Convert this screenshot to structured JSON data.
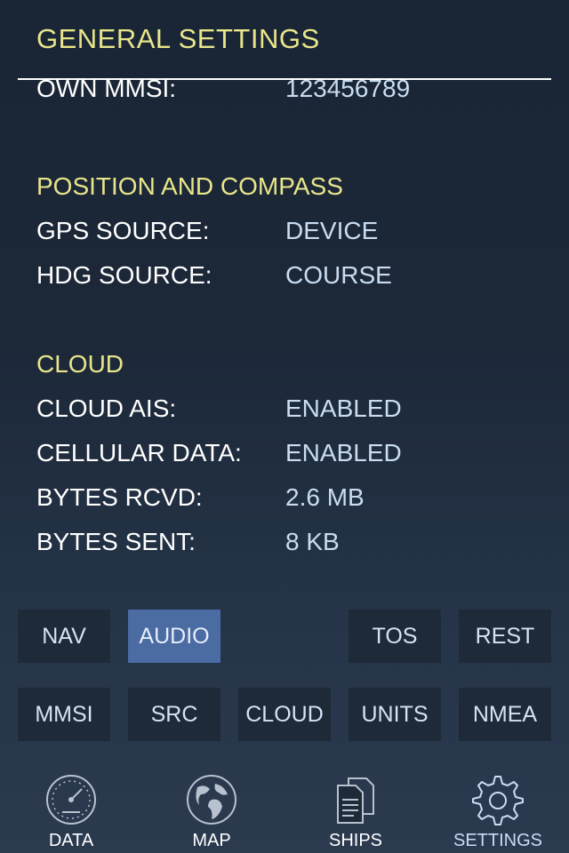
{
  "header": {
    "title": "GENERAL SETTINGS"
  },
  "cut_row": {
    "label": "OWN MMSI:",
    "value": "123456789"
  },
  "sections": {
    "position": {
      "title": "POSITION AND COMPASS",
      "rows": [
        {
          "label": "GPS SOURCE:",
          "value": "DEVICE"
        },
        {
          "label": "HDG SOURCE:",
          "value": "COURSE"
        }
      ]
    },
    "cloud": {
      "title": "CLOUD",
      "rows": [
        {
          "label": "CLOUD AIS:",
          "value": "ENABLED"
        },
        {
          "label": "CELLULAR DATA:",
          "value": "ENABLED"
        },
        {
          "label": "BYTES RCVD:",
          "value": "2.6 MB"
        },
        {
          "label": "BYTES SENT:",
          "value": "8 KB"
        }
      ]
    }
  },
  "buttons": {
    "row1": [
      "NAV",
      "AUDIO",
      "TOS",
      "REST"
    ],
    "row2": [
      "MMSI",
      "SRC",
      "CLOUD",
      "UNITS",
      "NMEA"
    ],
    "active": "AUDIO"
  },
  "tabs": [
    {
      "label": "DATA",
      "icon": "gauge-icon"
    },
    {
      "label": "MAP",
      "icon": "globe-icon"
    },
    {
      "label": "SHIPS",
      "icon": "documents-icon"
    },
    {
      "label": "SETTINGS",
      "icon": "gear-icon"
    }
  ],
  "selected_tab": "SETTINGS",
  "colors": {
    "section_title": "#e8e58a",
    "value_text": "#c9dcf2",
    "active_button": "#4b6ba3",
    "button_bg": "#1f2a38"
  }
}
